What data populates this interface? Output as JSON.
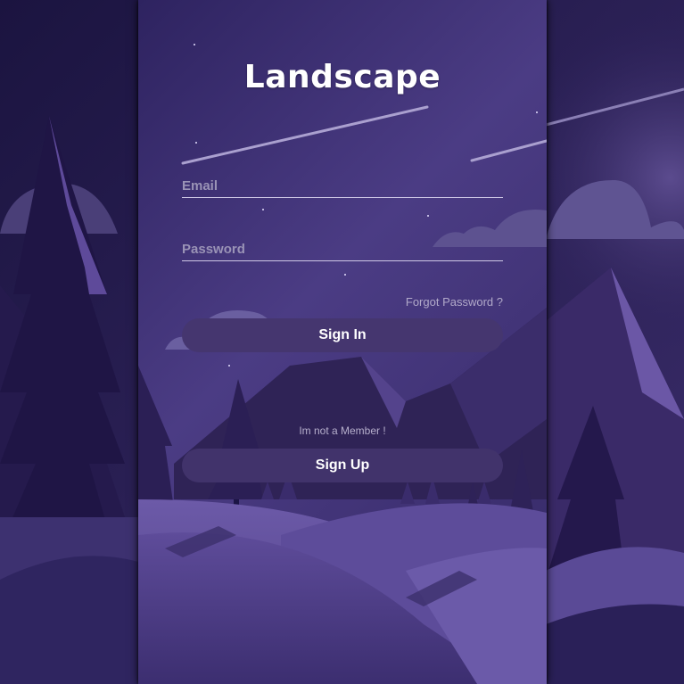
{
  "app": {
    "title": "Landscape"
  },
  "form": {
    "email_placeholder": "Email",
    "email_value": "",
    "password_placeholder": "Password",
    "password_value": "",
    "forgot_label": "Forgot Password ?",
    "signin_label": "Sign In",
    "member_text": "Im not a Member !",
    "signup_label": "Sign Up"
  },
  "colors": {
    "background": "#2a1f55",
    "button": "#45366f",
    "text": "#ffffff",
    "muted_text": "#b1a9c9"
  },
  "icons": [
    "tree-illustration",
    "mountain-illustration",
    "cloud-illustration",
    "shooting-star"
  ]
}
